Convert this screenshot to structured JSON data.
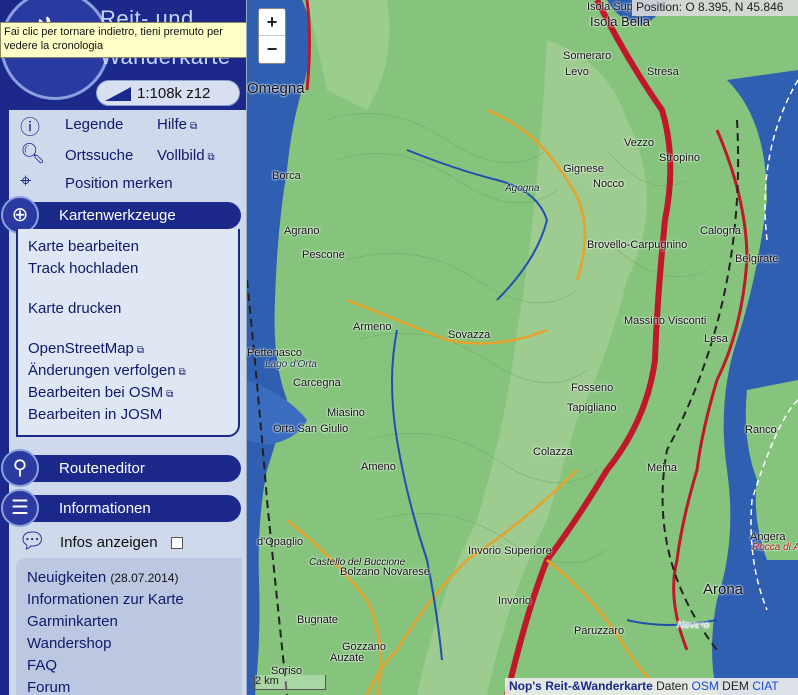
{
  "header": {
    "title_line1": "Reit- und",
    "title_line2": "Wanderkarte",
    "scale_label": "1:108k z12",
    "tooltip": "Fai clic per tornare indietro, tieni premuto per vedere la cronologia"
  },
  "quicklinks": [
    {
      "label": "Legende",
      "icon": "info-icon"
    },
    {
      "label": "Hilfe",
      "external": true
    },
    {
      "label": "Ortssuche",
      "icon": "magnifier-icon"
    },
    {
      "label": "Vollbild",
      "external": true
    },
    {
      "label": "Position merken",
      "icon": "crosshair-icon"
    }
  ],
  "sections": {
    "kartenwerkzeuge": {
      "title": "Kartenwerkzeuge",
      "items": [
        {
          "label": "Karte bearbeiten"
        },
        {
          "label": "Track hochladen"
        },
        {
          "label": "Karte drucken"
        },
        {
          "label": "OpenStreetMap",
          "external": true
        },
        {
          "label": "Änderungen verfolgen",
          "external": true
        },
        {
          "label": "Bearbeiten bei OSM",
          "external": true
        },
        {
          "label": "Bearbeiten in JOSM"
        }
      ]
    },
    "routeneditor": {
      "title": "Routeneditor"
    },
    "informationen": {
      "title": "Informationen",
      "infos_label": "Infos anzeigen",
      "infos_checked": false
    }
  },
  "news": [
    {
      "label": "Neuigkeiten",
      "date": "(28.07.2014)"
    },
    {
      "label": "Informationen zur Karte"
    },
    {
      "label": "Garminkarten"
    },
    {
      "label": "Wandershop"
    },
    {
      "label": "FAQ"
    },
    {
      "label": "Forum"
    }
  ],
  "map": {
    "zoom_in": "+",
    "zoom_out": "−",
    "position": "Position: O 8.395, N 45.846",
    "scalebar": "2 km",
    "attribution": {
      "brand": "Nop's Reit-&Wanderkarte",
      "daten": "Daten",
      "osm": "OSM",
      "dem": "DEM",
      "ciat": "CIAT"
    },
    "colors": {
      "lake": "#2f5fb0",
      "terrain": "#7fbf7a",
      "highway": "#c0182a",
      "road": "#e8a22a",
      "accent": "#1b2a8a"
    },
    "places": [
      {
        "name": "Isola Bella",
        "size": "mid"
      },
      {
        "name": "Isola Supe",
        "size": "small"
      },
      {
        "name": "Someraro",
        "size": "small"
      },
      {
        "name": "Levo",
        "size": "small"
      },
      {
        "name": "Stresa",
        "size": "small"
      },
      {
        "name": "Omegna",
        "size": "big"
      },
      {
        "name": "Vezzo",
        "size": "small"
      },
      {
        "name": "Stropino",
        "size": "small"
      },
      {
        "name": "Gignese",
        "size": "small"
      },
      {
        "name": "Nocco",
        "size": "small"
      },
      {
        "name": "Borca",
        "size": "small"
      },
      {
        "name": "Agrano",
        "size": "small"
      },
      {
        "name": "Pescone",
        "size": "small"
      },
      {
        "name": "Calogna",
        "size": "small"
      },
      {
        "name": "Brovello-Carpugnino",
        "size": "small"
      },
      {
        "name": "Belgirate",
        "size": "small"
      },
      {
        "name": "Armeno",
        "size": "small"
      },
      {
        "name": "Sovazza",
        "size": "small"
      },
      {
        "name": "Massino Visconti",
        "size": "small"
      },
      {
        "name": "Lesa",
        "size": "small"
      },
      {
        "name": "Pettenasco",
        "size": "small"
      },
      {
        "name": "Lago d'Orta",
        "size": "small"
      },
      {
        "name": "Carcegna",
        "size": "small"
      },
      {
        "name": "Fosseno",
        "size": "small"
      },
      {
        "name": "Tapigliano",
        "size": "small"
      },
      {
        "name": "Miasino",
        "size": "small"
      },
      {
        "name": "Orta San Giulio",
        "size": "small"
      },
      {
        "name": "Ranco",
        "size": "small"
      },
      {
        "name": "Ameno",
        "size": "small"
      },
      {
        "name": "Colazza",
        "size": "small"
      },
      {
        "name": "Meina",
        "size": "small"
      },
      {
        "name": "Angera",
        "size": "small"
      },
      {
        "name": "Rocca di Angera",
        "size": "small"
      },
      {
        "name": "d'Opaglio",
        "size": "small"
      },
      {
        "name": "Castello del Buccione",
        "size": "small"
      },
      {
        "name": "Bolzano Novarese",
        "size": "small"
      },
      {
        "name": "Invorio Superiore",
        "size": "small"
      },
      {
        "name": "Invorio",
        "size": "small"
      },
      {
        "name": "Arona",
        "size": "big"
      },
      {
        "name": "Bugnate",
        "size": "small"
      },
      {
        "name": "Paruzzaro",
        "size": "small"
      },
      {
        "name": "Auzate",
        "size": "small"
      },
      {
        "name": "Gozzano",
        "size": "small"
      },
      {
        "name": "Soriso",
        "size": "small"
      },
      {
        "name": "Nevero",
        "size": "small"
      },
      {
        "name": "Agogna",
        "size": "small"
      }
    ]
  }
}
